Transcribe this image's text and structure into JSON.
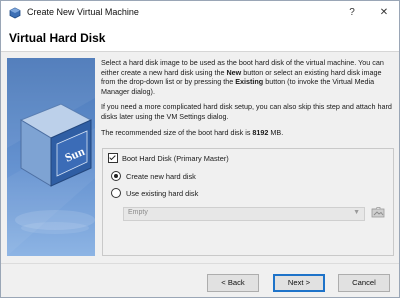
{
  "window": {
    "title": "Create New Virtual Machine",
    "help_glyph": "?",
    "close_glyph": "✕"
  },
  "page": {
    "title": "Virtual Hard Disk"
  },
  "illustration": {
    "logo_text": "Sun"
  },
  "content": {
    "p1_a": "Select a hard disk image to be used as the boot hard disk of the virtual machine. You can either create a new hard disk using the ",
    "p1_new": "New",
    "p1_b": " button or select an existing hard disk image from the drop-down list or by pressing the ",
    "p1_existing": "Existing",
    "p1_c": " button (to invoke the Virtual Media Manager dialog).",
    "p2": "If you need a more complicated hard disk setup, you can also skip this step and attach hard disks later using the VM Settings dialog.",
    "p3_a": "The recommended size of the boot hard disk is ",
    "p3_size": "8192",
    "p3_b": " MB."
  },
  "boot_disk": {
    "checkbox_label": "Boot Hard Disk (Primary Master)",
    "checked": true,
    "options": [
      {
        "label": "Create new hard disk",
        "selected": true
      },
      {
        "label": "Use existing hard disk",
        "selected": false
      }
    ],
    "existing_select_value": "Empty"
  },
  "footer": {
    "back_label": "< Back",
    "next_label": "Next >",
    "cancel_label": "Cancel"
  },
  "colors": {
    "accent": "#1e73c9",
    "illustration_top": "#4a78b8",
    "illustration_bottom": "#8db4e4"
  }
}
